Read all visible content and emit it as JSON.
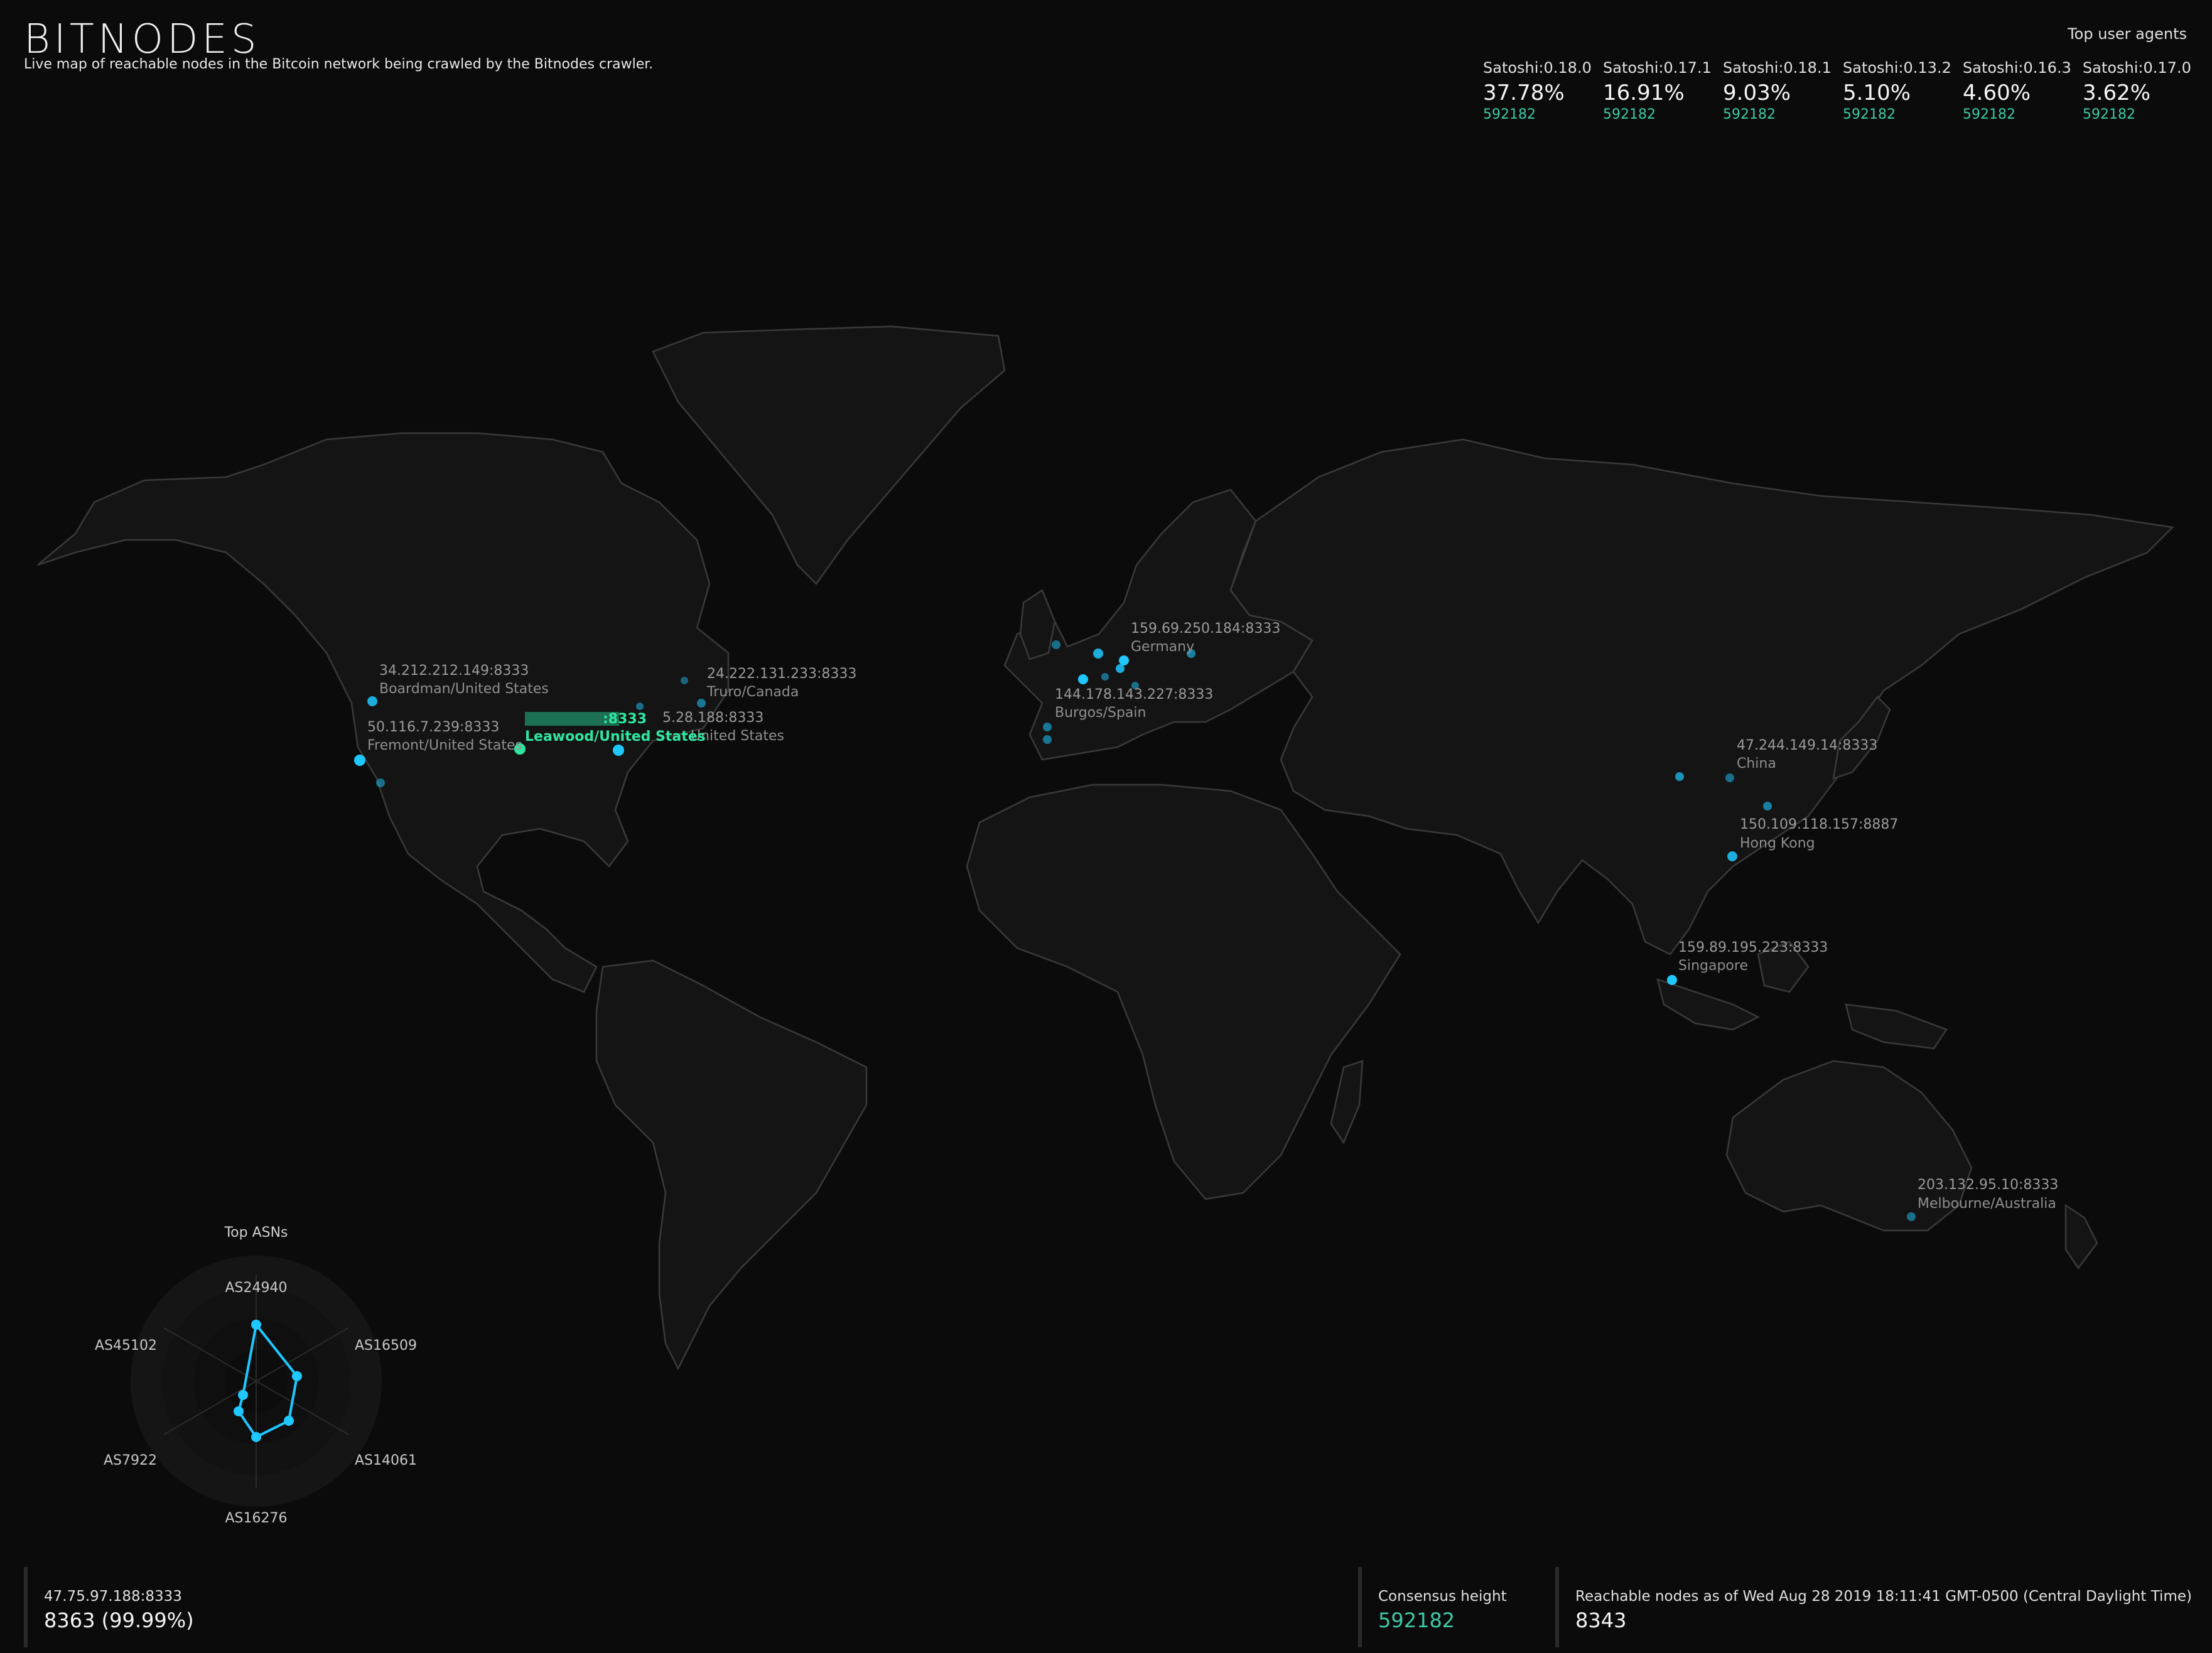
{
  "header": {
    "logo": "BITNODES",
    "tagline": "Live map of reachable nodes in the Bitcoin network being crawled by the Bitnodes crawler."
  },
  "user_agents": {
    "title": "Top user agents",
    "items": [
      {
        "name": "Satoshi:0.18.0",
        "pct": "37.78%",
        "height": "592182"
      },
      {
        "name": "Satoshi:0.17.1",
        "pct": "16.91%",
        "height": "592182"
      },
      {
        "name": "Satoshi:0.18.1",
        "pct": "9.03%",
        "height": "592182"
      },
      {
        "name": "Satoshi:0.13.2",
        "pct": "5.10%",
        "height": "592182"
      },
      {
        "name": "Satoshi:0.16.3",
        "pct": "4.60%",
        "height": "592182"
      },
      {
        "name": "Satoshi:0.17.0",
        "pct": "3.62%",
        "height": "592182"
      }
    ]
  },
  "nodes": [
    {
      "addr": "34.212.212.149:8333",
      "loc": "Boardman/United States"
    },
    {
      "addr": "50.116.7.239:8333",
      "loc": "Fremont/United States"
    },
    {
      "addr": "24.222.131.233:8333",
      "loc": "Truro/Canada"
    },
    {
      "addr": "5.28.188:8333",
      "loc": "United States"
    },
    {
      "addr": "159.69.250.184:8333",
      "loc": "Germany"
    },
    {
      "addr": "144.178.143.227:8333",
      "loc": "Burgos/Spain"
    },
    {
      "addr": "47.244.149.14:8333",
      "loc": "China"
    },
    {
      "addr": "150.109.118.157:8887",
      "loc": "Hong Kong"
    },
    {
      "addr": "159.89.195.223:8333",
      "loc": "Singapore"
    },
    {
      "addr": "203.132.95.10:8333",
      "loc": "Melbourne/Australia"
    }
  ],
  "highlight_node": {
    "addr": ":8333",
    "loc": "Leawood/United States"
  },
  "colors": {
    "accent": "#1ec8ff",
    "green": "#3ec9a6",
    "highlight": "#2fe6a0"
  },
  "asns": {
    "title": "Top ASNs",
    "labels": [
      "AS24940",
      "AS16509",
      "AS14061",
      "AS16276",
      "AS7922",
      "AS45102"
    ]
  },
  "footer": {
    "current_node": {
      "label": "47.75.97.188:8333",
      "value": "8363 (99.99%)"
    },
    "consensus": {
      "label": "Consensus height",
      "value": "592182"
    },
    "reachable": {
      "label": "Reachable nodes as of Wed Aug 28 2019 18:11:41 GMT-0500 (Central Daylight Time)",
      "value": "8343"
    }
  }
}
